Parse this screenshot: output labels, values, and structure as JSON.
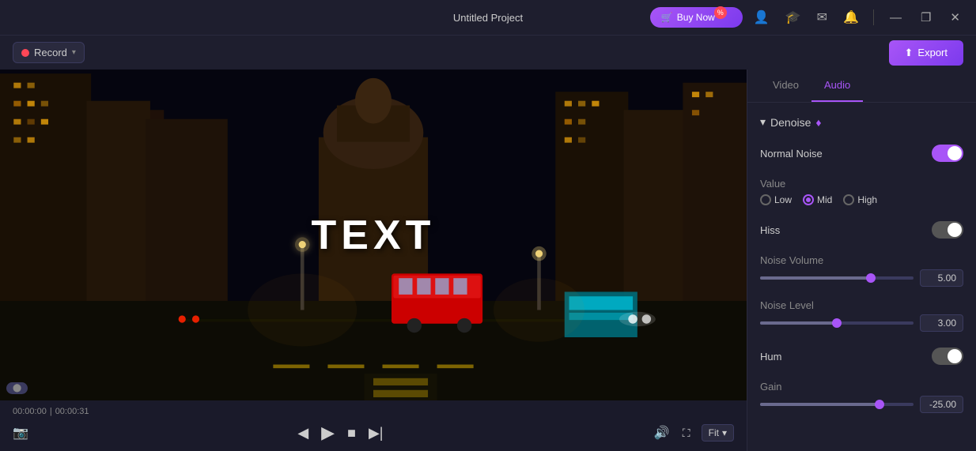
{
  "app": {
    "title": "Untitled Project"
  },
  "titlebar": {
    "buy_now": "Buy Now",
    "min": "—",
    "max": "❐",
    "close": "✕"
  },
  "toolbar": {
    "record_label": "Record",
    "export_label": "Export"
  },
  "video": {
    "text_overlay": "TEXT",
    "time_current": "00:00:00",
    "time_total": "00:00:31",
    "fit_label": "Fit"
  },
  "tabs": [
    {
      "id": "video",
      "label": "Video",
      "active": false
    },
    {
      "id": "audio",
      "label": "Audio",
      "active": true
    }
  ],
  "audio_panel": {
    "section_denoise": "Denoise",
    "normal_noise_label": "Normal Noise",
    "normal_noise_on": true,
    "value_label": "Value",
    "radio_options": [
      {
        "id": "low",
        "label": "Low",
        "selected": false
      },
      {
        "id": "mid",
        "label": "Mid",
        "selected": true
      },
      {
        "id": "high",
        "label": "High",
        "selected": false
      }
    ],
    "hiss_label": "Hiss",
    "hiss_on": true,
    "noise_volume_label": "Noise Volume",
    "noise_volume_value": "5.00",
    "noise_volume_pct": 72,
    "noise_level_label": "Noise Level",
    "noise_level_value": "3.00",
    "noise_level_pct": 50,
    "hum_label": "Hum",
    "hum_on": true,
    "gain_label": "Gain",
    "gain_value": "-25.00",
    "gain_pct": 78
  },
  "icons": {
    "record": "●",
    "cart": "🛒",
    "user": "👤",
    "graduation": "🎓",
    "mail": "✉",
    "bell": "🔔",
    "export_arrow": "⬆",
    "chevron_left": "◀",
    "play": "▶",
    "stop": "■",
    "chevron_right": "▶|",
    "volume": "🔊",
    "fullscreen": "⛶",
    "camera": "📷",
    "chevron_down": "▾",
    "chevron_section": "▾"
  }
}
